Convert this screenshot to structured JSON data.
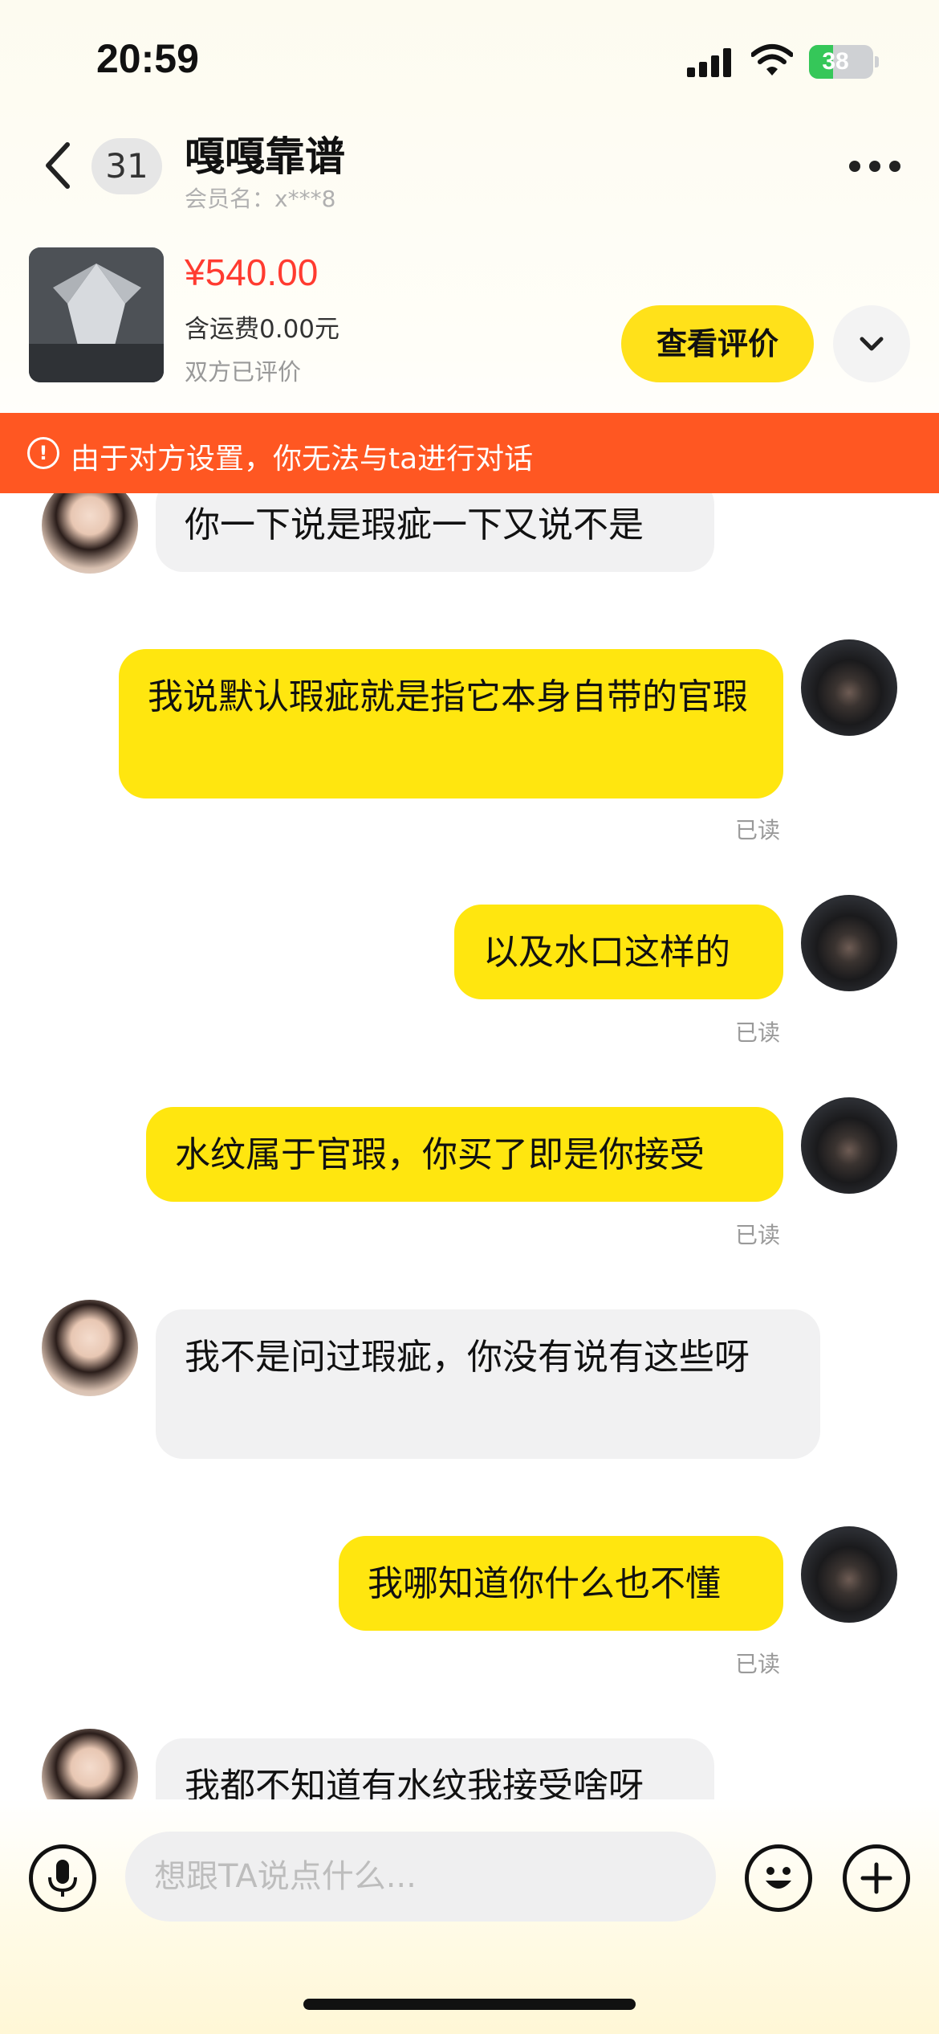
{
  "status_bar": {
    "time": "20:59",
    "battery": "38",
    "battery_level": 0.38
  },
  "header": {
    "unread_count": "31",
    "title": "嘎嘎靠谱",
    "member_label": "会员名：x***8"
  },
  "product": {
    "price": "¥540.00",
    "shipping": "含运费0.00元",
    "review_status": "双方已评价",
    "review_button": "查看评价"
  },
  "banner": {
    "text": "由于对方设置，你无法与ta进行对话"
  },
  "colors": {
    "accent": "#ffe11a",
    "my_bubble": "#ffe60f",
    "banner": "#ff5722",
    "price": "#ff3b30"
  },
  "messages": [
    {
      "side": "other",
      "text": "你一下说是瑕疵一下又说不是"
    },
    {
      "side": "me",
      "text": "我说默认瑕疵就是指它本身自带的官瑕",
      "status": "已读"
    },
    {
      "side": "me",
      "text": "以及水口这样的",
      "status": "已读"
    },
    {
      "side": "me",
      "text": "水纹属于官瑕，你买了即是你接受",
      "status": "已读"
    },
    {
      "side": "other",
      "text": "我不是问过瑕疵，你没有说有这些呀"
    },
    {
      "side": "me",
      "text": "我哪知道你什么也不懂",
      "status": "已读"
    },
    {
      "side": "other",
      "text": "我都不知道有水纹我接受啥呀"
    }
  ],
  "input": {
    "placeholder": "想跟TA说点什么..."
  },
  "icons": [
    "back-icon",
    "more-icon",
    "warning-icon",
    "chevron-down-icon",
    "mic-icon",
    "emoji-icon",
    "plus-icon"
  ]
}
